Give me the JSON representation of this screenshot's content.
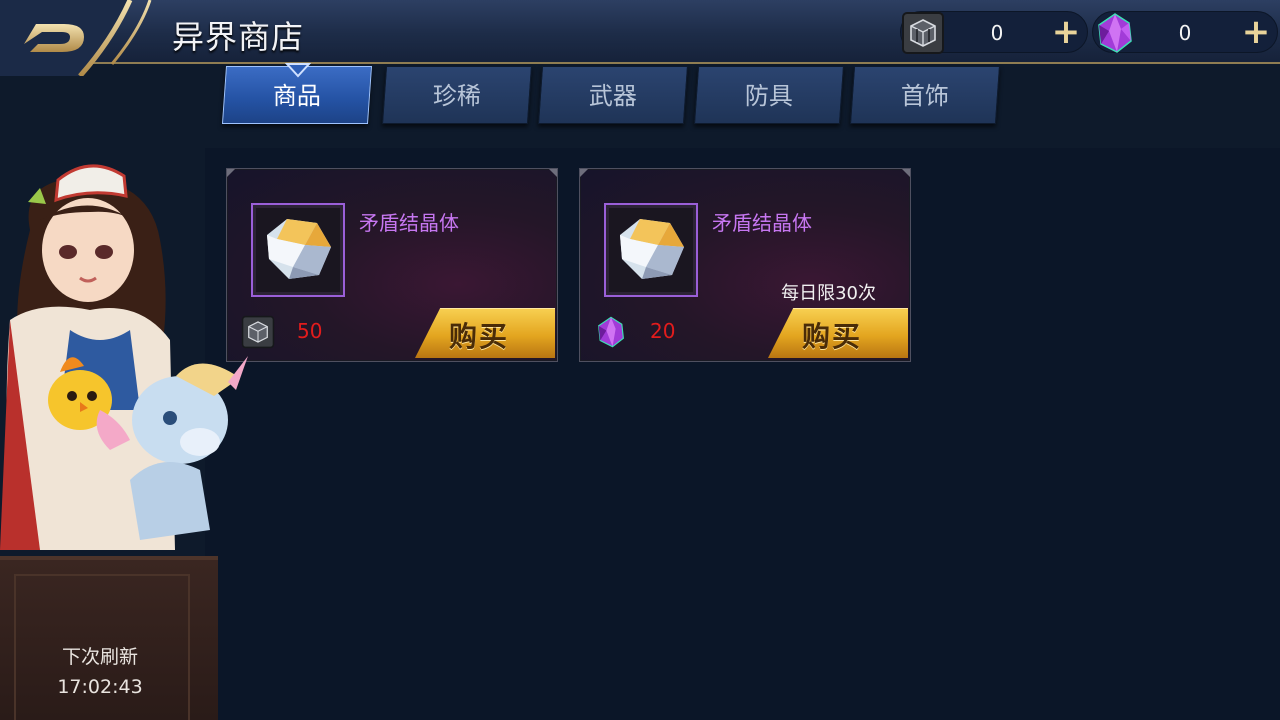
{
  "header": {
    "title": "异界商店"
  },
  "currencies": [
    {
      "icon": "cube-token-icon",
      "amount": "0"
    },
    {
      "icon": "purple-crystal-icon",
      "amount": "0"
    }
  ],
  "tabs": [
    {
      "label": "商品",
      "active": true
    },
    {
      "label": "珍稀",
      "active": false
    },
    {
      "label": "武器",
      "active": false
    },
    {
      "label": "防具",
      "active": false
    },
    {
      "label": "首饰",
      "active": false
    }
  ],
  "items": [
    {
      "name": "矛盾结晶体",
      "limit": "",
      "price_icon": "cube-token-icon",
      "price": "50",
      "buy_label": "购买"
    },
    {
      "name": "矛盾结晶体",
      "limit": "每日限30次",
      "price_icon": "purple-crystal-icon",
      "price": "20",
      "buy_label": "购买"
    }
  ],
  "refresh": {
    "label": "下次刷新",
    "time": "17:02:43"
  },
  "colors": {
    "accent_gold": "#e3a51f",
    "item_name_purple": "#c676f0",
    "price_red": "#e21c1c",
    "active_tab_blue": "#2452a3"
  }
}
